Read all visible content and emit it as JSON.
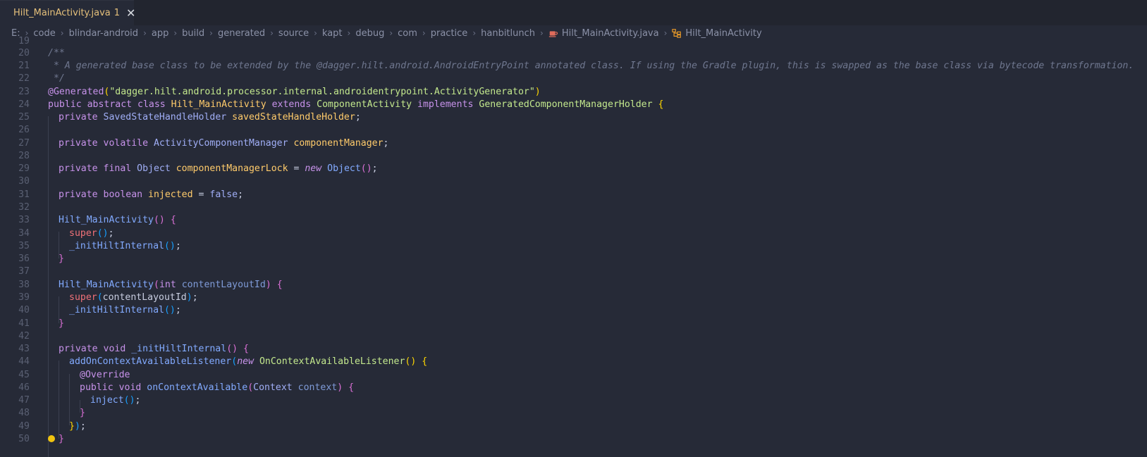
{
  "tab": {
    "title": "Hilt_MainActivity.java",
    "badge": "1",
    "close": "✕",
    "icon": "java-file-icon"
  },
  "breadcrumbs": [
    "E:",
    "code",
    "blindar-android",
    "app",
    "build",
    "generated",
    "source",
    "kapt",
    "debug",
    "com",
    "practice",
    "hanbitlunch",
    "Hilt_MainActivity.java",
    "Hilt_MainActivity"
  ],
  "colors": {
    "background": "#262a37",
    "keyword": "#c792ea",
    "class_name": "#ffcb6b",
    "string": "#c3e88d",
    "function": "#82aaff",
    "comment": "#6f778f"
  },
  "code": {
    "ln19": "19",
    "ln20": "20",
    "l20a": "/**",
    "ln21": "21",
    "l21a": " * A generated base class to be extended by the @dagger.hilt.android.AndroidEntryPoint annotated class. If using the Gradle plugin, this is swapped as the base class via bytecode transformation.",
    "ln22": "22",
    "l22a": " */",
    "ln23": "23",
    "l23a": "@Generated",
    "l23b": "(",
    "l23c": "\"dagger.hilt.android.processor.internal.androidentrypoint.ActivityGenerator\"",
    "l23d": ")",
    "ln24": "24",
    "l24a": "public abstract class ",
    "l24b": "Hilt_MainActivity",
    "l24c": " extends ",
    "l24d": "ComponentActivity",
    "l24e": " implements ",
    "l24f": "GeneratedComponentManagerHolder",
    "l24g": " ",
    "l24h": "{",
    "ln25": "25",
    "l25a": "private ",
    "l25b": "SavedStateHandleHolder",
    "l25c": " savedStateHandleHolder",
    "l25d": ";",
    "ln26": "26",
    "ln27": "27",
    "l27a": "private volatile ",
    "l27b": "ActivityComponentManager",
    "l27c": " componentManager",
    "l27d": ";",
    "ln28": "28",
    "ln29": "29",
    "l29a": "private final ",
    "l29b": "Object",
    "l29c": " componentManagerLock",
    "l29d": " = ",
    "l29e": "new",
    "l29f": " Object",
    "l29g": "()",
    "l29h": ";",
    "ln30": "30",
    "ln31": "31",
    "l31a": "private ",
    "l31b": "boolean",
    "l31c": " injected",
    "l31d": " = ",
    "l31e": "false",
    "l31f": ";",
    "ln32": "32",
    "ln33": "33",
    "l33a": "Hilt_MainActivity",
    "l33b": "()",
    "l33c": " {",
    "ln34": "34",
    "l34a": "super",
    "l34b": "()",
    "l34c": ";",
    "ln35": "35",
    "l35a": "_initHiltInternal",
    "l35b": "()",
    "l35c": ";",
    "ln36": "36",
    "l36a": "}",
    "ln37": "37",
    "ln38": "38",
    "l38a": "Hilt_MainActivity",
    "l38b": "(",
    "l38c": "int",
    "l38d": " contentLayoutId",
    "l38e": ")",
    "l38f": " {",
    "ln39": "39",
    "l39a": "super",
    "l39b": "(",
    "l39c": "contentLayoutId",
    "l39d": ")",
    "l39e": ";",
    "ln40": "40",
    "l40a": "_initHiltInternal",
    "l40b": "()",
    "l40c": ";",
    "ln41": "41",
    "l41a": "}",
    "ln42": "42",
    "ln43": "43",
    "l43a": "private void ",
    "l43b": "_initHiltInternal",
    "l43c": "()",
    "l43d": " {",
    "ln44": "44",
    "l44a": "addOnContextAvailableListener",
    "l44b": "(",
    "l44c": "new",
    "l44d": " OnContextAvailableListener",
    "l44e": "()",
    "l44f": " {",
    "ln45": "45",
    "l45a": "@Override",
    "ln46": "46",
    "l46a": "public void ",
    "l46b": "onContextAvailable",
    "l46c": "(",
    "l46d": "Context",
    "l46e": " context",
    "l46f": ")",
    "l46g": " {",
    "ln47": "47",
    "l47a": "inject",
    "l47b": "()",
    "l47c": ";",
    "ln48": "48",
    "l48a": "}",
    "ln49": "49",
    "l49a": "}",
    "l49b": ")",
    "l49c": ";",
    "ln50": "50",
    "l50a": "}"
  }
}
